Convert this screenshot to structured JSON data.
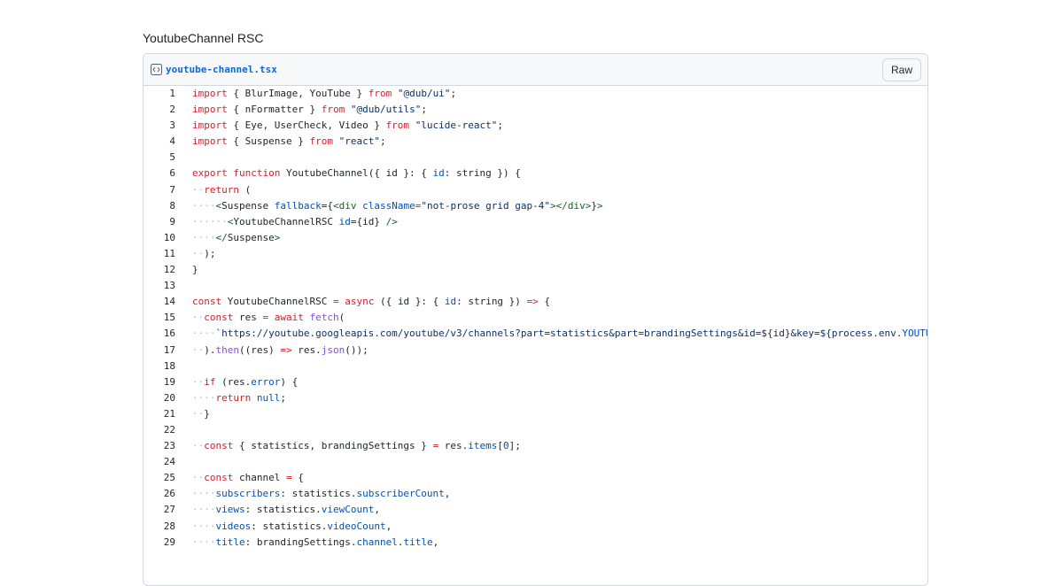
{
  "page": {
    "title": "YoutubeChannel RSC"
  },
  "file": {
    "name": "youtube-channel.tsx",
    "raw_label": "Raw",
    "icon": "code-file-icon"
  },
  "lines": [
    "import { BlurImage, YouTube } from \"@dub/ui\";",
    "import { nFormatter } from \"@dub/utils\";",
    "import { Eye, UserCheck, Video } from \"lucide-react\";",
    "import { Suspense } from \"react\";",
    "",
    "export function YoutubeChannel({ id }: { id: string }) {",
    "··return (",
    "····<Suspense fallback={<div className=\"not-prose grid gap-4\"></div>}>",
    "······<YoutubeChannelRSC id={id} />",
    "····</Suspense>",
    "··);",
    "}",
    "",
    "const YoutubeChannelRSC = async ({ id }: { id: string }) => {",
    "··const res = await fetch(",
    "····`https://youtube.googleapis.com/youtube/v3/channels?part=statistics&part=brandingSettings&id=${id}&key=${process.env.YOUTUBE",
    "··).then((res) => res.json());",
    "",
    "··if (res.error) {",
    "····return null;",
    "··}",
    "",
    "··const { statistics, brandingSettings } = res.items[0];",
    "",
    "··const channel = {",
    "····subscribers: statistics.subscriberCount,",
    "····views: statistics.viewCount,",
    "····videos: statistics.videoCount,",
    "····title: brandingSettings.channel.title,"
  ]
}
